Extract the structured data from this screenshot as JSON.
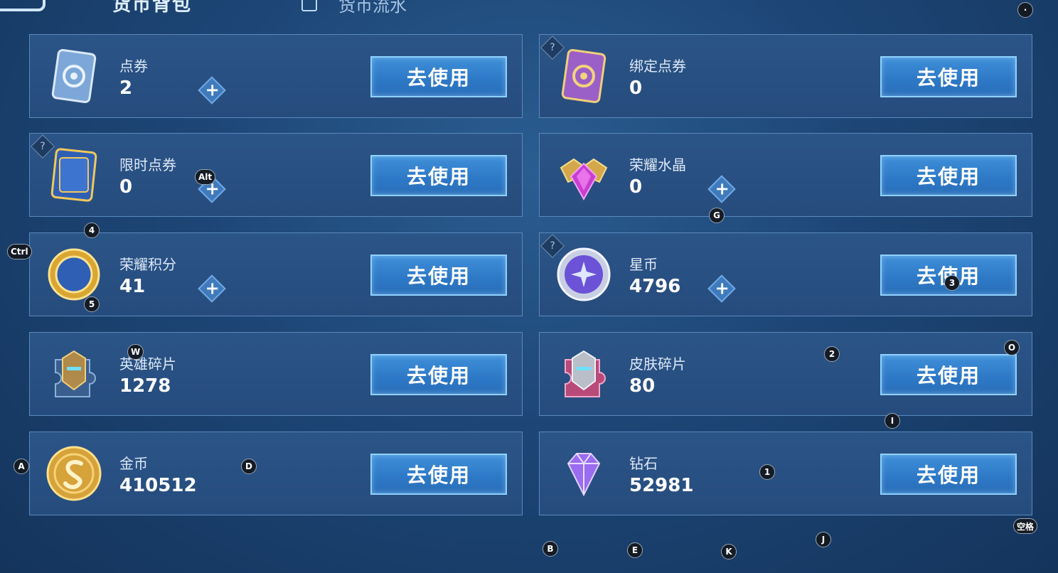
{
  "header": {
    "tab_bag_label": "货币背包",
    "tab_flow_label": "货币流水"
  },
  "use_label": "去使用",
  "plus_label": "+",
  "help_label": "?",
  "currencies": [
    {
      "name": "点券",
      "amount": "2",
      "icon": "coupon-card-icon",
      "color": "#7ca7d8"
    },
    {
      "name": "绑定点券",
      "amount": "0",
      "icon": "bound-coupon-card-icon",
      "color": "#9b5fc8"
    },
    {
      "name": "限时点券",
      "amount": "0",
      "icon": "limited-coupon-icon",
      "color": "#2f5fb5"
    },
    {
      "name": "荣耀水晶",
      "amount": "0",
      "icon": "glory-crystal-icon",
      "color": "#c83fd0"
    },
    {
      "name": "荣耀积分",
      "amount": "41",
      "icon": "glory-points-icon",
      "color": "#d9a632"
    },
    {
      "name": "星币",
      "amount": "4796",
      "icon": "star-coin-icon",
      "color": "#6b52d6"
    },
    {
      "name": "英雄碎片",
      "amount": "1278",
      "icon": "hero-fragment-icon",
      "color": "#b08a4a"
    },
    {
      "name": "皮肤碎片",
      "amount": "80",
      "icon": "skin-fragment-icon",
      "color": "#b84a7a"
    },
    {
      "name": "金币",
      "amount": "410512",
      "icon": "gold-coin-icon",
      "color": "#d6a23a"
    },
    {
      "name": "钻石",
      "amount": "52981",
      "icon": "diamond-icon",
      "color": "#9a6cf0"
    }
  ],
  "hotkeys": [
    "Alt",
    "4",
    "Ctrl",
    "5",
    "G",
    "3",
    "W",
    "2",
    "O",
    "I",
    "A",
    "D",
    "1",
    "空格",
    "B",
    "E",
    "K",
    "J"
  ]
}
